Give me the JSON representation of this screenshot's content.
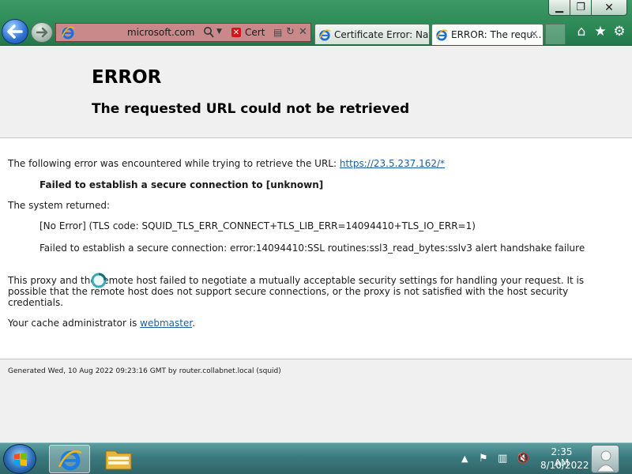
{
  "window": {
    "minimize_glyph": "▁",
    "maximize_glyph": "❐",
    "close_glyph": "✕"
  },
  "address_bar": {
    "url": "microsoft.com",
    "cert_label": "Cert",
    "background_color": "#c9898a"
  },
  "tabs": [
    {
      "label": "Certificate Error: Nav...",
      "icon": "ie-icon",
      "active": false
    },
    {
      "label": "ERROR: The requ...",
      "icon": "ie-icon",
      "active": true
    }
  ],
  "command_icons": [
    "home-icon",
    "favorites-icon",
    "tools-icon"
  ],
  "page": {
    "title": "ERROR",
    "subtitle": "The requested URL could not be retrieved",
    "intro_text": "The following error was encountered while trying to retrieve the URL: ",
    "intro_link": "https://23.5.237.162/*",
    "failed_text": "Failed to establish a secure connection to [unknown]",
    "system_returned": "The system returned:",
    "no_error_text": "[No Error] (TLS code: SQUID_TLS_ERR_CONNECT+TLS_LIB_ERR=14094410+TLS_IO_ERR=1)",
    "failed_detail": "Failed to establish a secure connection: error:14094410:SSL routines:ssl3_read_bytes:sslv3 alert handshake failure",
    "proxy_text": "This proxy and the remote host failed to negotiate a mutually acceptable security settings for handling your request. It is possible that the remote host does not support secure connections, or the proxy is not satisfied with the host security credentials.",
    "admin_text": "Your cache administrator is ",
    "admin_link": "webmaster",
    "admin_suffix": ".",
    "generated": "Generated Wed, 10 Aug 2022 09:23:16 GMT by router.collabnet.local (squid)"
  },
  "taskbar": {
    "time": "2:35 AM",
    "date": "8/10/2022"
  }
}
